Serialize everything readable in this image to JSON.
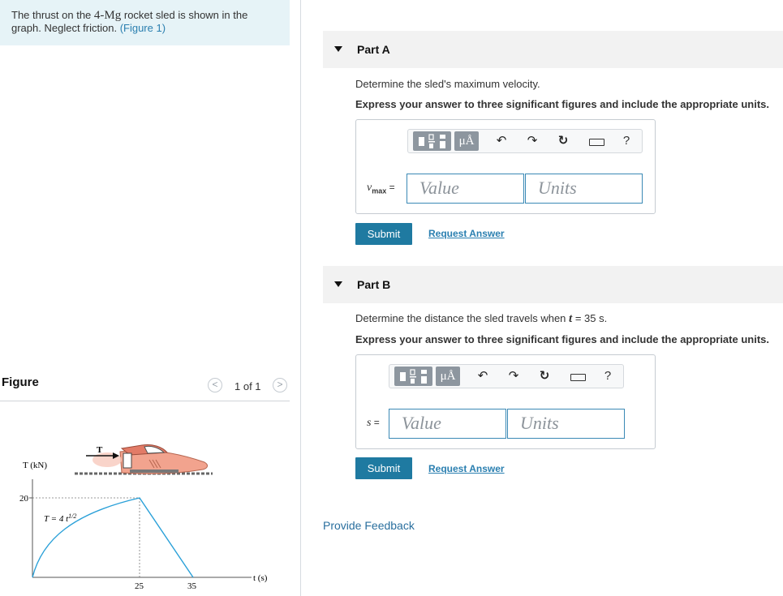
{
  "problem": {
    "text_before": "The thrust on the ",
    "mass": "4-Mg",
    "text_after": " rocket sled is shown in the graph. Neglect friction. ",
    "figure_link": "(Figure 1)"
  },
  "figure": {
    "title": "Figure",
    "pager": {
      "prev": "<",
      "count": "1 of 1",
      "next": ">"
    },
    "thrust_label": "T",
    "y_axis_label": "T (kN)",
    "x_axis_label": "t (s)",
    "y_tick": "20",
    "x_ticks": [
      "25",
      "35"
    ],
    "curve_label": "T = 4 t^1/2"
  },
  "parts": [
    {
      "header": "Part A",
      "question": "Determine the sled's maximum velocity.",
      "instruction": "Express your answer to three significant figures and include the appropriate units.",
      "variable": "v",
      "variable_sub": "max",
      "equals": "=",
      "value_placeholder": "Value",
      "units_placeholder": "Units",
      "submit": "Submit",
      "request": "Request Answer"
    },
    {
      "header": "Part B",
      "question_before": "Determine the distance the sled travels when ",
      "question_var": "t",
      "question_after": " = 35 s.",
      "instruction": "Express your answer to three significant figures and include the appropriate units.",
      "variable": "s",
      "equals": "=",
      "value_placeholder": "Value",
      "units_placeholder": "Units",
      "submit": "Submit",
      "request": "Request Answer"
    }
  ],
  "toolbar": {
    "units_symbol": "μÅ",
    "undo_icon": "↶",
    "redo_icon": "↷",
    "reset_icon": "↻",
    "help": "?"
  },
  "feedback": "Provide Feedback",
  "colors": {
    "accent": "#1f7aa1",
    "link": "#2a7fb0",
    "problem_bg": "#e6f3f7",
    "curve": "#2aa0d8"
  }
}
